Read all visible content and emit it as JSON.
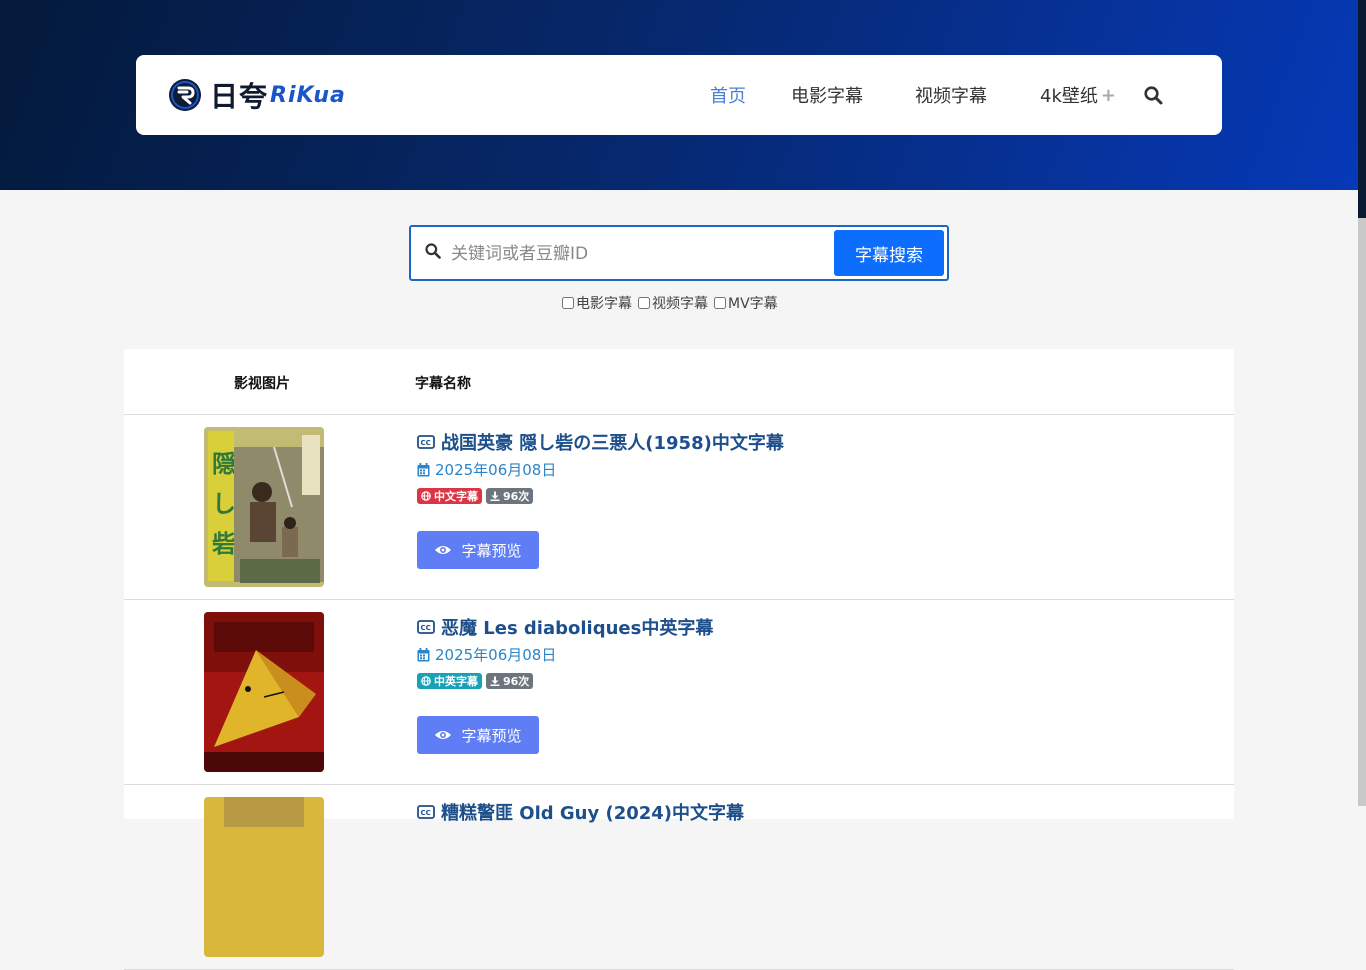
{
  "header": {
    "logo_cn": "日夸",
    "logo_en": "RiKua",
    "nav": {
      "home": "首页",
      "movie": "电影字幕",
      "video": "视频字幕",
      "wallpaper": "4k壁纸",
      "wallpaper_more": "+"
    }
  },
  "search": {
    "placeholder": "关键词或者豆瓣ID",
    "value": "",
    "button": "字幕搜索",
    "filters": [
      {
        "label": "电影字幕",
        "checked": false
      },
      {
        "label": "视频字幕",
        "checked": false
      },
      {
        "label": "MV字幕",
        "checked": false
      }
    ]
  },
  "table": {
    "col_image": "影视图片",
    "col_name": "字幕名称",
    "rows": [
      {
        "title": "战国英豪 隠し砦の三悪人(1958)中文字幕",
        "date": "2025年06月08日",
        "lang_badge": "中文字幕",
        "lang_color": "#dc3545",
        "downloads": "96次",
        "preview": "字幕预览"
      },
      {
        "title": "恶魔 Les diaboliques中英字幕",
        "date": "2025年06月08日",
        "lang_badge": "中英字幕",
        "lang_color": "#17a2b8",
        "downloads": "96次",
        "preview": "字幕预览"
      },
      {
        "title": "糟糕警匪 Old Guy (2024)中文字幕"
      }
    ]
  },
  "colors": {
    "accent": "#0d6efd",
    "link": "#1d4f8c",
    "date": "#2a86c8",
    "preview_button": "#5f7df5"
  }
}
